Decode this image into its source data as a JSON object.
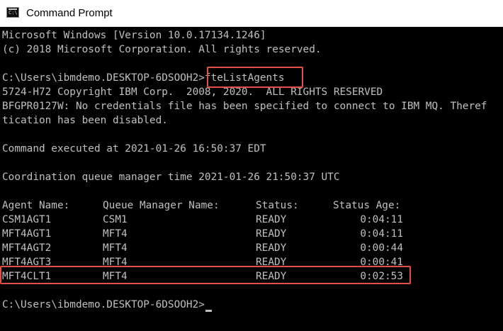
{
  "window": {
    "title": "Command Prompt",
    "icon": "command-prompt-icon",
    "icon_glyph": "C:\\"
  },
  "console": {
    "lines": [
      "Microsoft Windows [Version 10.0.17134.1246]",
      "(c) 2018 Microsoft Corporation. All rights reserved.",
      "",
      "C:\\Users\\ibmdemo.DESKTOP-6DSOOH2>fteListAgents",
      "5724-H72 Copyright IBM Corp.  2008, 2020.  ALL RIGHTS RESERVED",
      "BFGPR0127W: No credentials file has been specified to connect to IBM MQ. Theref",
      "tication has been disabled.",
      "",
      "Command executed at 2021-01-26 16:50:37 EDT",
      "",
      "Coordination queue manager time 2021-01-26 21:50:37 UTC"
    ],
    "prompt": "C:\\Users\\ibmdemo.DESKTOP-6DSOOH2>",
    "command": "fteListAgents"
  },
  "agents_table": {
    "headers": [
      "Agent Name:",
      "Queue Manager Name:",
      "Status:",
      "Status Age:"
    ],
    "rows": [
      [
        "CSM1AGT1",
        "CSM1",
        "READY",
        "0:04:11"
      ],
      [
        "MFT4AGT1",
        "MFT4",
        "READY",
        "0:04:11"
      ],
      [
        "MFT4AGT2",
        "MFT4",
        "READY",
        "0:00:44"
      ],
      [
        "MFT4AGT3",
        "MFT4",
        "READY",
        "0:00:41"
      ],
      [
        "MFT4CLT1",
        "MFT4",
        "READY",
        "0:02:53"
      ]
    ]
  },
  "final_prompt": "C:\\Users\\ibmdemo.DESKTOP-6DSOOH2>",
  "colors": {
    "console_bg": "#000000",
    "console_text": "#c0c0c0",
    "highlight": "#e15046"
  }
}
